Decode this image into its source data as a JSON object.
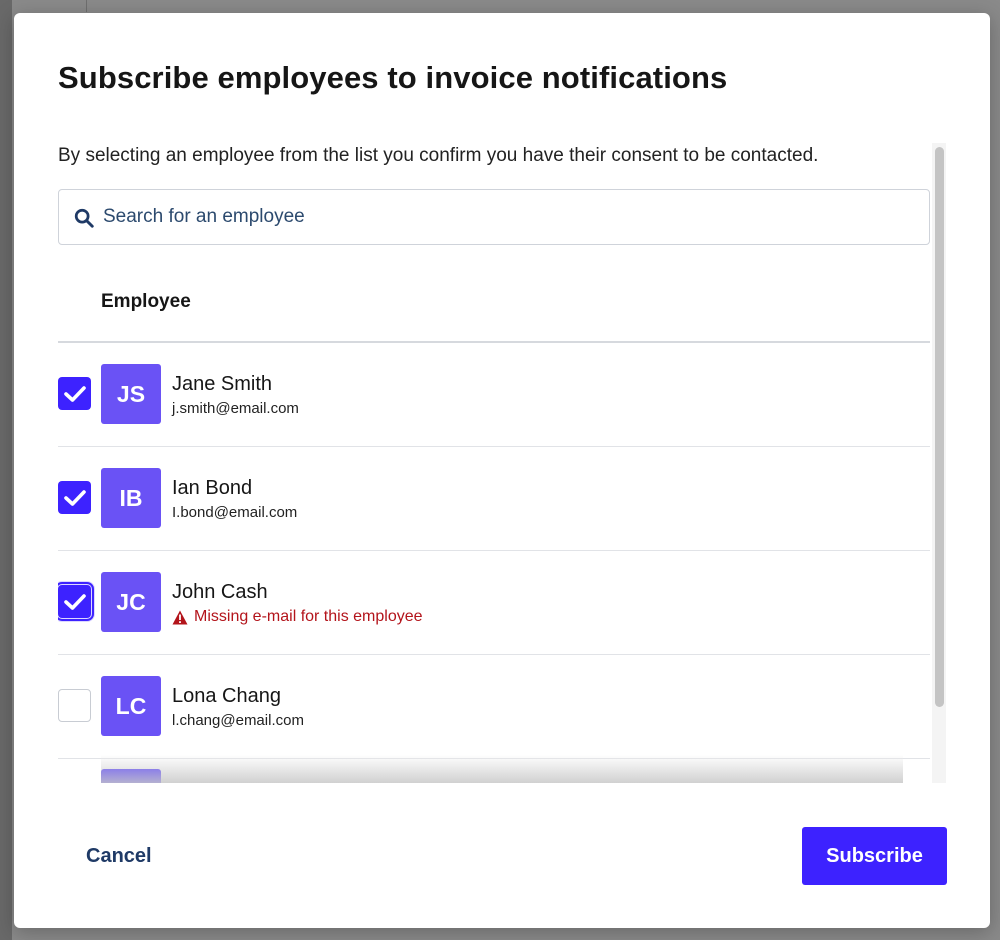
{
  "dialog": {
    "title": "Subscribe employees to invoice notifications",
    "consent_text": "By selecting an employee from the list you confirm you have their consent to be contacted.",
    "search": {
      "placeholder": "Search for an employee",
      "value": ""
    },
    "column_header": "Employee",
    "employees": [
      {
        "initials": "JS",
        "name": "Jane Smith",
        "email": "j.smith@email.com",
        "checked": true,
        "warning": ""
      },
      {
        "initials": "IB",
        "name": "Ian Bond",
        "email": "I.bond@email.com",
        "checked": true,
        "warning": ""
      },
      {
        "initials": "JC",
        "name": "John Cash",
        "email": "",
        "checked": true,
        "warning": "Missing e-mail for this employee"
      },
      {
        "initials": "LC",
        "name": "Lona Chang",
        "email": "l.chang@email.com",
        "checked": false,
        "warning": ""
      }
    ],
    "cancel_label": "Cancel",
    "subscribe_label": "Subscribe"
  },
  "colors": {
    "accent": "#3d22ff",
    "avatar": "#6a52f5",
    "warning": "#b3141b",
    "link": "#1f3a66"
  },
  "icons": {
    "search": "search-icon",
    "check": "check-icon",
    "warning": "warning-triangle-icon"
  }
}
